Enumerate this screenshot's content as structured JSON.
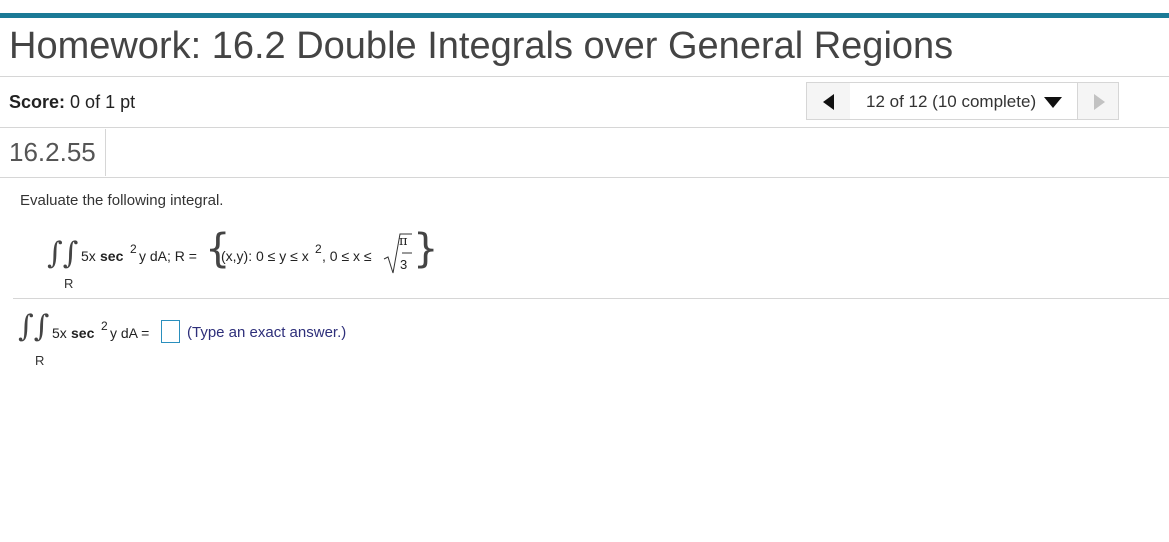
{
  "header": {
    "title": "Homework: 16.2 Double Integrals over General Regions"
  },
  "score": {
    "label": "Score:",
    "value": "0 of 1 pt"
  },
  "nav": {
    "position": "12 of 12 (10 complete)"
  },
  "question": {
    "number": "16.2.55",
    "instruction": "Evaluate the following integral.",
    "integrand_coef": "5x",
    "integrand_func": "sec",
    "integrand_exp": "2",
    "integrand_rest": "y dA; R =",
    "region_label": "R",
    "set_text_a": "(x,y): 0 ≤ y ≤ x",
    "set_exp": "2",
    "set_text_b": ", 0 ≤ x ≤",
    "frac_num": "π",
    "frac_den": "3",
    "answer_rest": "y dA =",
    "hint": "(Type an exact answer.)"
  },
  "colors": {
    "accent": "#1b7a96",
    "hint": "#2e2f7a",
    "input_border": "#2a8fbd"
  }
}
